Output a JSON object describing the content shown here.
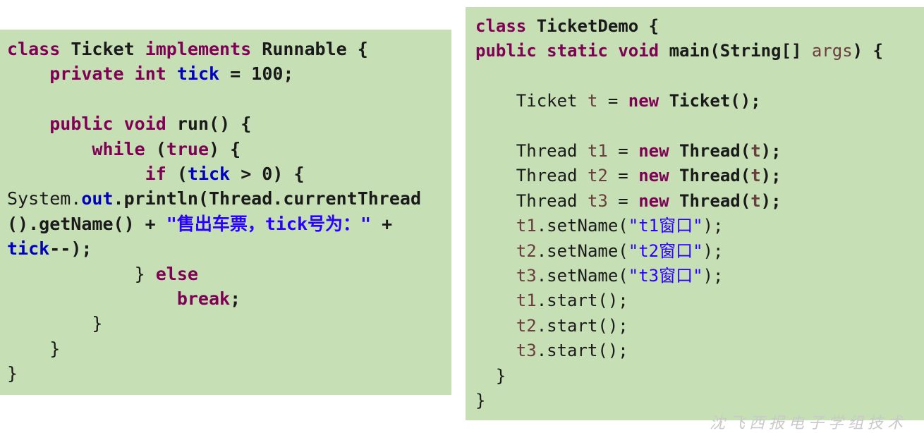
{
  "left_code": {
    "kw_class": "class",
    "class_name": "Ticket",
    "kw_implements": "implements",
    "iface": "Runnable",
    "kw_private": "private",
    "kw_int": "int",
    "field": "tick",
    "init_value": "100",
    "kw_public": "public",
    "kw_void": "void",
    "method": "run()",
    "kw_while": "while",
    "kw_true": "true",
    "kw_if": "if",
    "cond_tail": "> 0) {",
    "sys": "System.",
    "out": "out",
    "println": ".println(Thread.currentThread",
    "getname": "().getName() +",
    "string_literal": "\"售出车票，tick号为：\"",
    "plus": "+",
    "tick2": "tick",
    "decrement": "--);",
    "kw_else": "else",
    "kw_break": "break"
  },
  "right_code": {
    "kw_class": "class",
    "class_name": "TicketDemo",
    "kw_public": "public",
    "kw_static": "static",
    "kw_void": "void",
    "method": "main(String[]",
    "param": "args",
    "ticket_type": "Ticket",
    "ticket_var": "t",
    "kw_new": "new",
    "ticket_ctor": "Ticket();",
    "thread_type": "Thread",
    "thread_ctor": "Thread(",
    "threads": [
      {
        "var": "t1",
        "name": "\"t1窗口\""
      },
      {
        "var": "t2",
        "name": "\"t2窗口\""
      },
      {
        "var": "t3",
        "name": "\"t3窗口\""
      }
    ],
    "set_name": ".setName(",
    "start": ".start();"
  },
  "watermark": "沈飞西报电子学组技术"
}
